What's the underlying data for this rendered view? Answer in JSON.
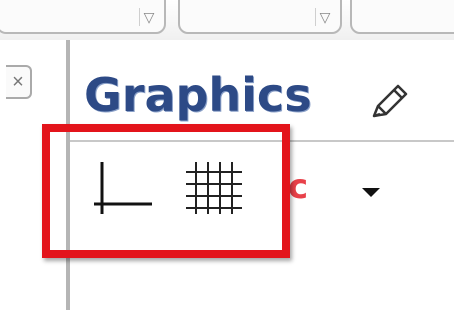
{
  "header": {
    "title": "Graphics"
  },
  "icons": {
    "style_bar_edit": "pencil-icon",
    "axes": "axes-icon",
    "grid": "grid-icon",
    "color": "color-icon",
    "more": "dropdown-arrow-icon",
    "close": "close-icon"
  },
  "colors": {
    "title": "#2d4a86",
    "highlight": "#e3141b",
    "accent_red": "#e8414a"
  }
}
